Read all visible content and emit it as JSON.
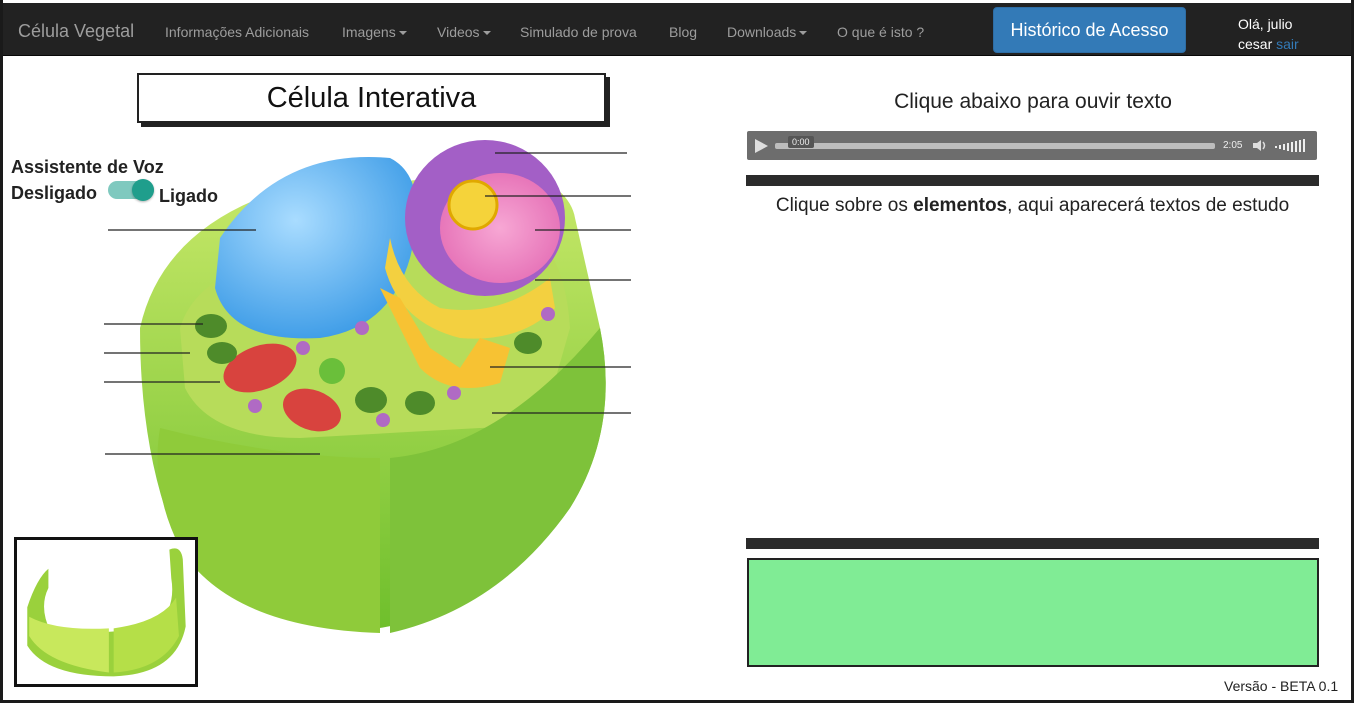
{
  "navbar": {
    "brand": "Célula Vegetal",
    "items": [
      {
        "label": "Informações Adicionais",
        "dropdown": false
      },
      {
        "label": "Imagens",
        "dropdown": true
      },
      {
        "label": "Videos",
        "dropdown": true
      },
      {
        "label": "Simulado de prova",
        "dropdown": false
      },
      {
        "label": "Blog",
        "dropdown": false
      },
      {
        "label": "Downloads",
        "dropdown": true
      },
      {
        "label": "O que é isto ?",
        "dropdown": false
      }
    ],
    "history_button": "Histórico de Acesso",
    "greeting_line1": "Olá, julio",
    "greeting_line2": "cesar",
    "logout_link": "sair"
  },
  "left": {
    "title": "Célula Interativa",
    "voice_assistant": {
      "title": "Assistente de Voz",
      "off_label": "Desligado",
      "on_label": "Ligado",
      "state": "on"
    }
  },
  "right": {
    "audio_title": "Clique abaixo para ouvir texto",
    "audio": {
      "current_time": "0:00",
      "duration": "2:05"
    },
    "hint_prefix": "Clique sobre os ",
    "hint_bold": "elementos",
    "hint_suffix": ", aqui aparecerá textos de estudo"
  },
  "footer": {
    "version": "Versão - BETA 0.1"
  },
  "colors": {
    "navbar_bg": "#222222",
    "primary_button": "#337ab7",
    "answer_box": "#80ec95",
    "switch_on": "#1f9e8c"
  },
  "icons": [
    "play-icon",
    "volume-icon",
    "volume-level-icon",
    "caret-down-icon"
  ]
}
